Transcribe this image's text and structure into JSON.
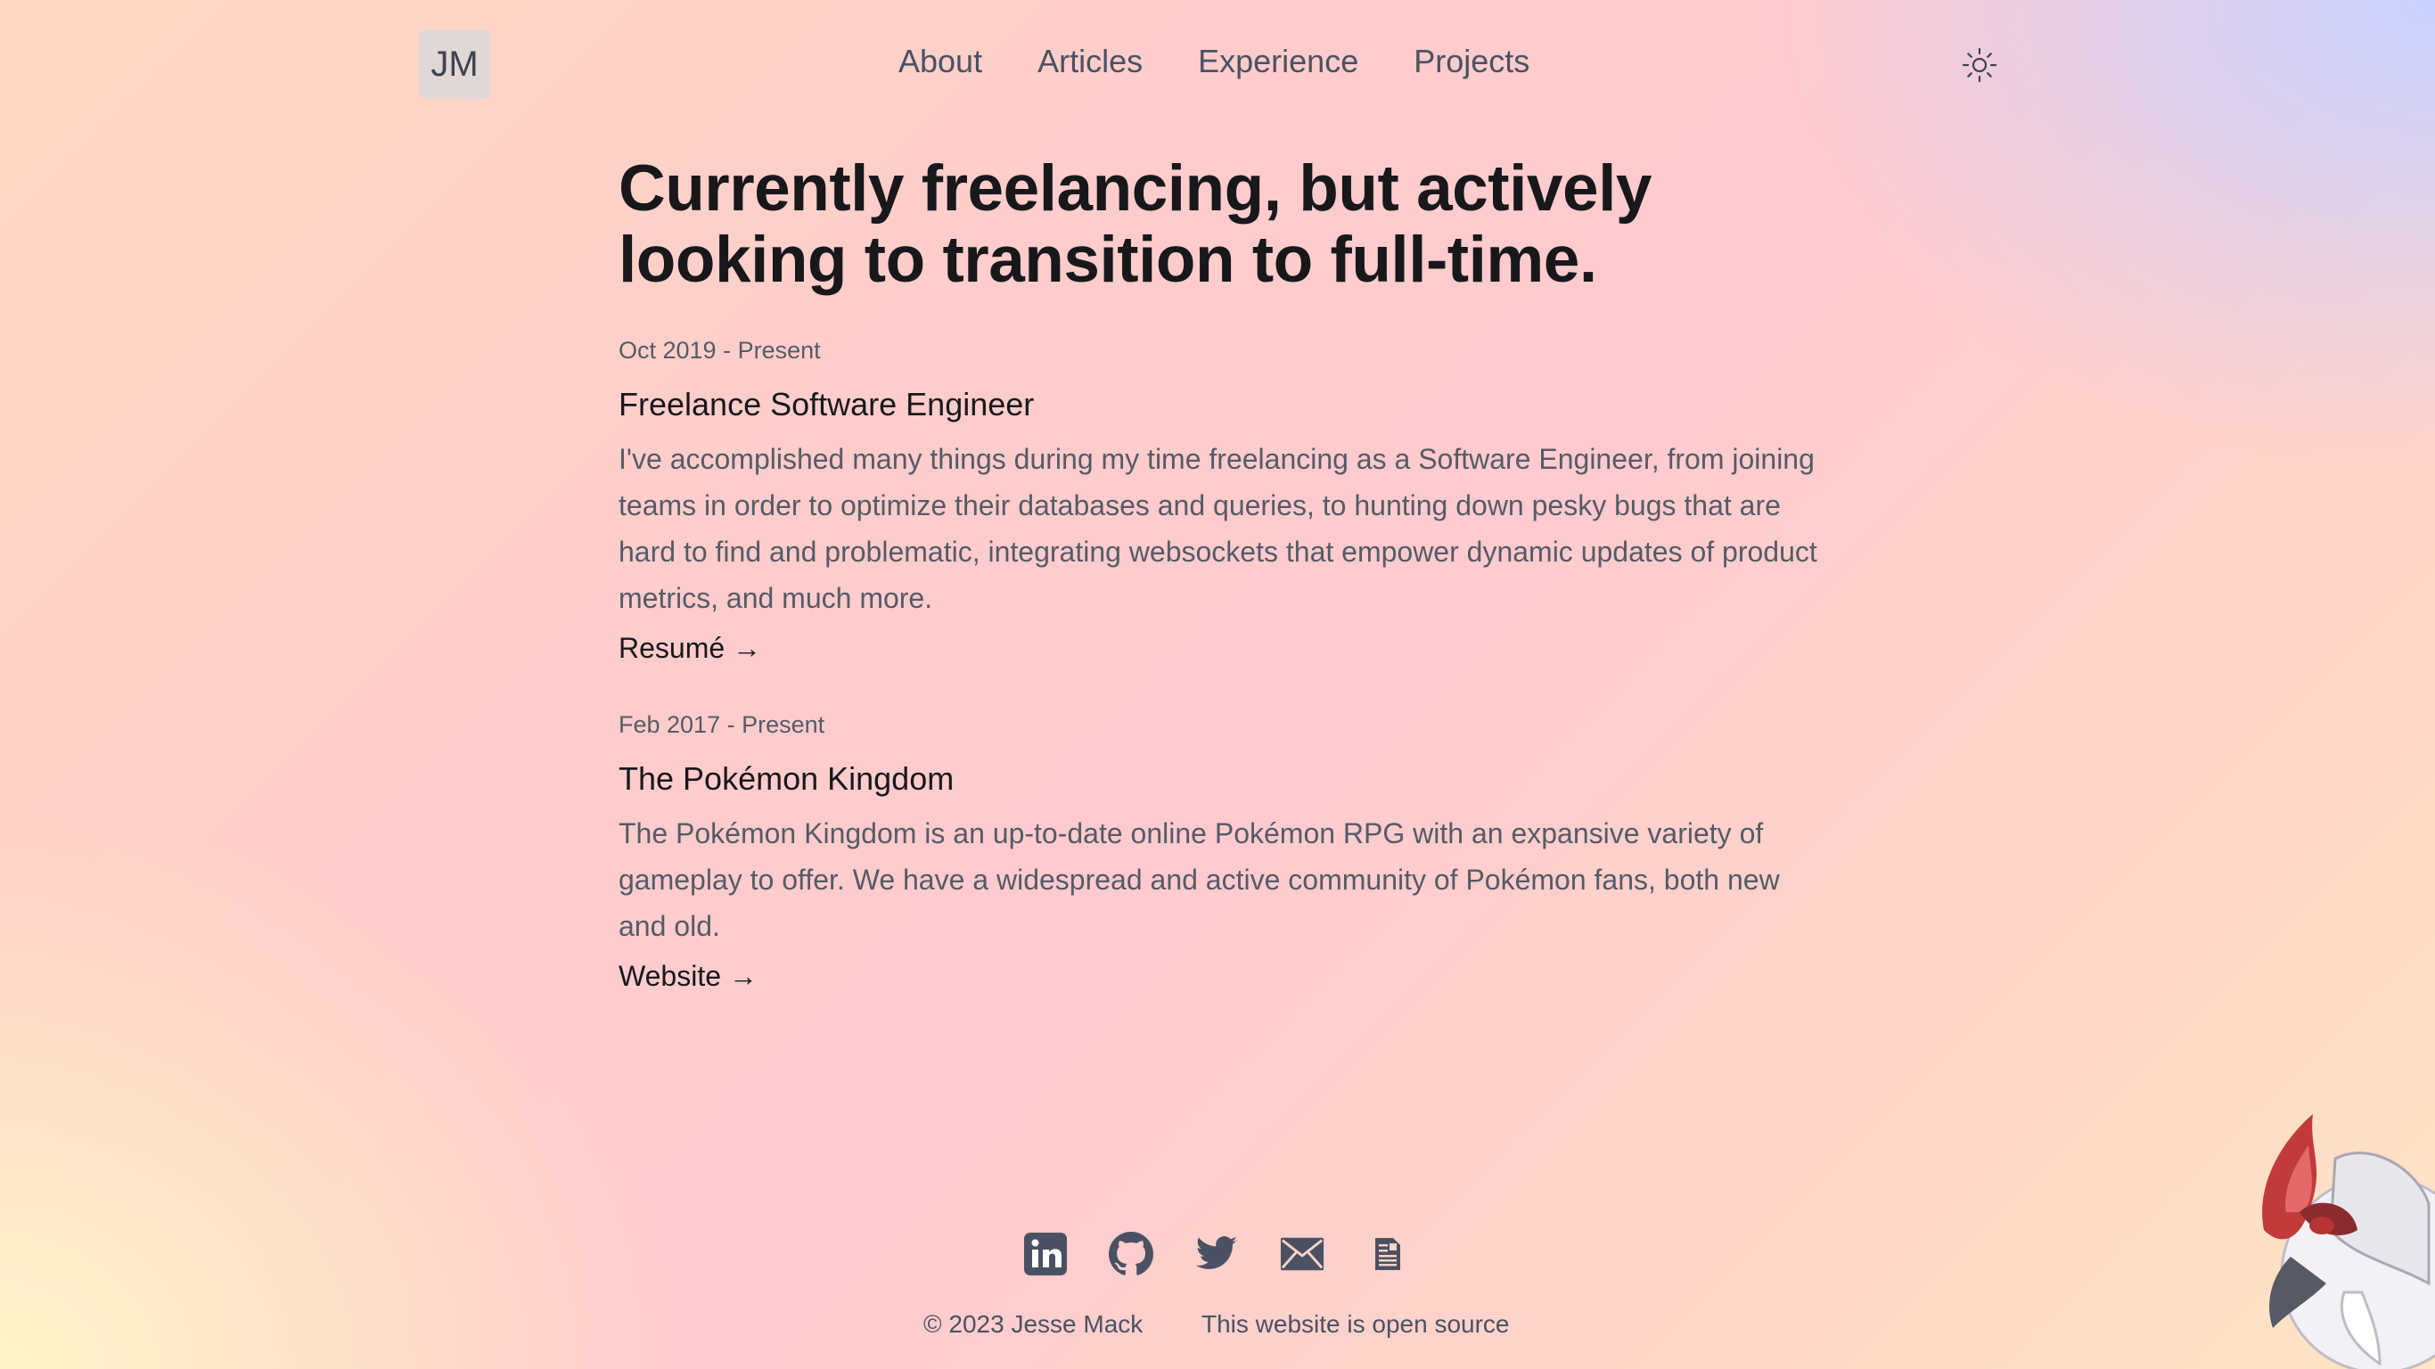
{
  "header": {
    "logo": "JM",
    "nav": [
      "About",
      "Articles",
      "Experience",
      "Projects"
    ],
    "theme_icon": "sun-icon"
  },
  "main": {
    "heading_line1": "Currently freelancing, but actively",
    "heading_line2": "looking to transition to full-time.",
    "entries": [
      {
        "date": "Oct 2019 - Present",
        "title": "Freelance Software Engineer",
        "description": "I've accomplished many things during my time freelancing as a Software Engineer, from joining teams in order to optimize their databases and queries, to hunting down pesky bugs that are hard to find and problematic, integrating websockets that empower dynamic updates of product metrics, and much more.",
        "link": "Resumé →"
      },
      {
        "date": "Feb 2017 - Present",
        "title": "The Pokémon Kingdom",
        "description": "The Pokémon Kingdom is an up-to-date online Pokémon RPG with an expansive variety of gameplay to offer. We have a widespread and active community of Pokémon fans, both new and old.",
        "link": "Website →"
      }
    ]
  },
  "footer": {
    "icons": [
      "linkedin-icon",
      "github-icon",
      "twitter-icon",
      "mail-icon",
      "document-icon"
    ],
    "copyright": "© 2023 Jesse Mack",
    "open_source": "This website is open source"
  },
  "colors": {
    "text_dark": "#18181b",
    "text_muted": "#555b66",
    "icon": "#4a5163"
  }
}
